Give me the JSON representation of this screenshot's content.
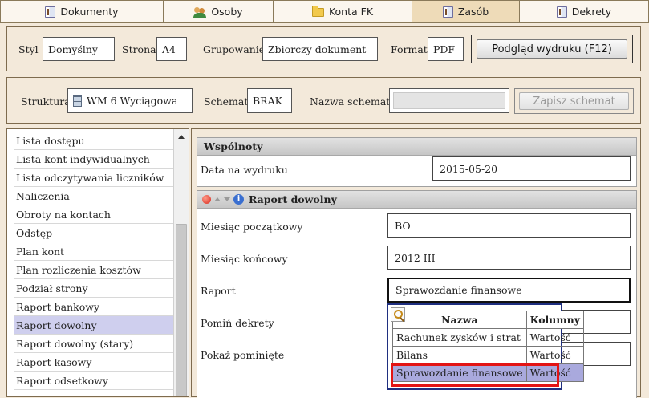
{
  "tabs": [
    {
      "label": "Dokumenty",
      "icon": "document-icon",
      "active": false
    },
    {
      "label": "Osoby",
      "icon": "people-icon",
      "active": false
    },
    {
      "label": "Konta FK",
      "icon": "folder-icon",
      "active": false
    },
    {
      "label": "Zasób",
      "icon": "document-icon",
      "active": true
    },
    {
      "label": "Dekrety",
      "icon": "document-icon",
      "active": false
    }
  ],
  "print": {
    "style_label": "Styl",
    "style_value": "Domyślny",
    "page_label": "Strona",
    "page_value": "A4",
    "grouping_label": "Grupowanie",
    "grouping_value": "Zbiorczy dokument",
    "format_label": "Format",
    "format_value": "PDF",
    "preview_button": "Podgląd wydruku (F12)"
  },
  "structure": {
    "structure_label": "Struktura",
    "structure_value": "WM 6 Wyciągowa",
    "scheme_label": "Schemat",
    "scheme_value": "BRAK",
    "scheme_name_label": "Nazwa schematu",
    "scheme_name_value": "",
    "save_button": "Zapisz schemat"
  },
  "report_list": {
    "items": [
      "Lista dostępu",
      "Lista kont indywidualnych",
      "Lista odczytywania liczników",
      "Naliczenia",
      "Obroty na kontach",
      "Odstęp",
      "Plan kont",
      "Plan rozliczenia kosztów",
      "Podział strony",
      "Raport bankowy",
      "Raport dowolny",
      "Raport dowolny (stary)",
      "Raport kasowy",
      "Raport odsetkowy"
    ],
    "selected_index": 10
  },
  "wspolnoty": {
    "header": "Wspólnoty",
    "date_label": "Data na wydruku",
    "date_value": "2015-05-20"
  },
  "raport": {
    "header": "Raport dowolny",
    "start_month_label": "Miesiąc początkowy",
    "start_month_value": "BO",
    "end_month_label": "Miesiąc końcowy",
    "end_month_value": "2012 III",
    "report_label": "Raport",
    "report_value": "Sprawozdanie finansowe",
    "skip_label": "Pomiń dekrety",
    "show_skipped_label": "Pokaż pominięte"
  },
  "dropdown": {
    "col_name": "Nazwa",
    "col_columns": "Kolumny",
    "rows": [
      {
        "name": "Rachunek zysków i strat",
        "columns": "Wartość"
      },
      {
        "name": "Bilans",
        "columns": "Wartość"
      },
      {
        "name": "Sprawozdanie finansowe",
        "columns": "Wartość"
      }
    ],
    "selected_index": 2
  },
  "colors": {
    "accent_highlight": "#e31414",
    "selection": "#cfcfee",
    "active_tab": "#eedbb8"
  }
}
